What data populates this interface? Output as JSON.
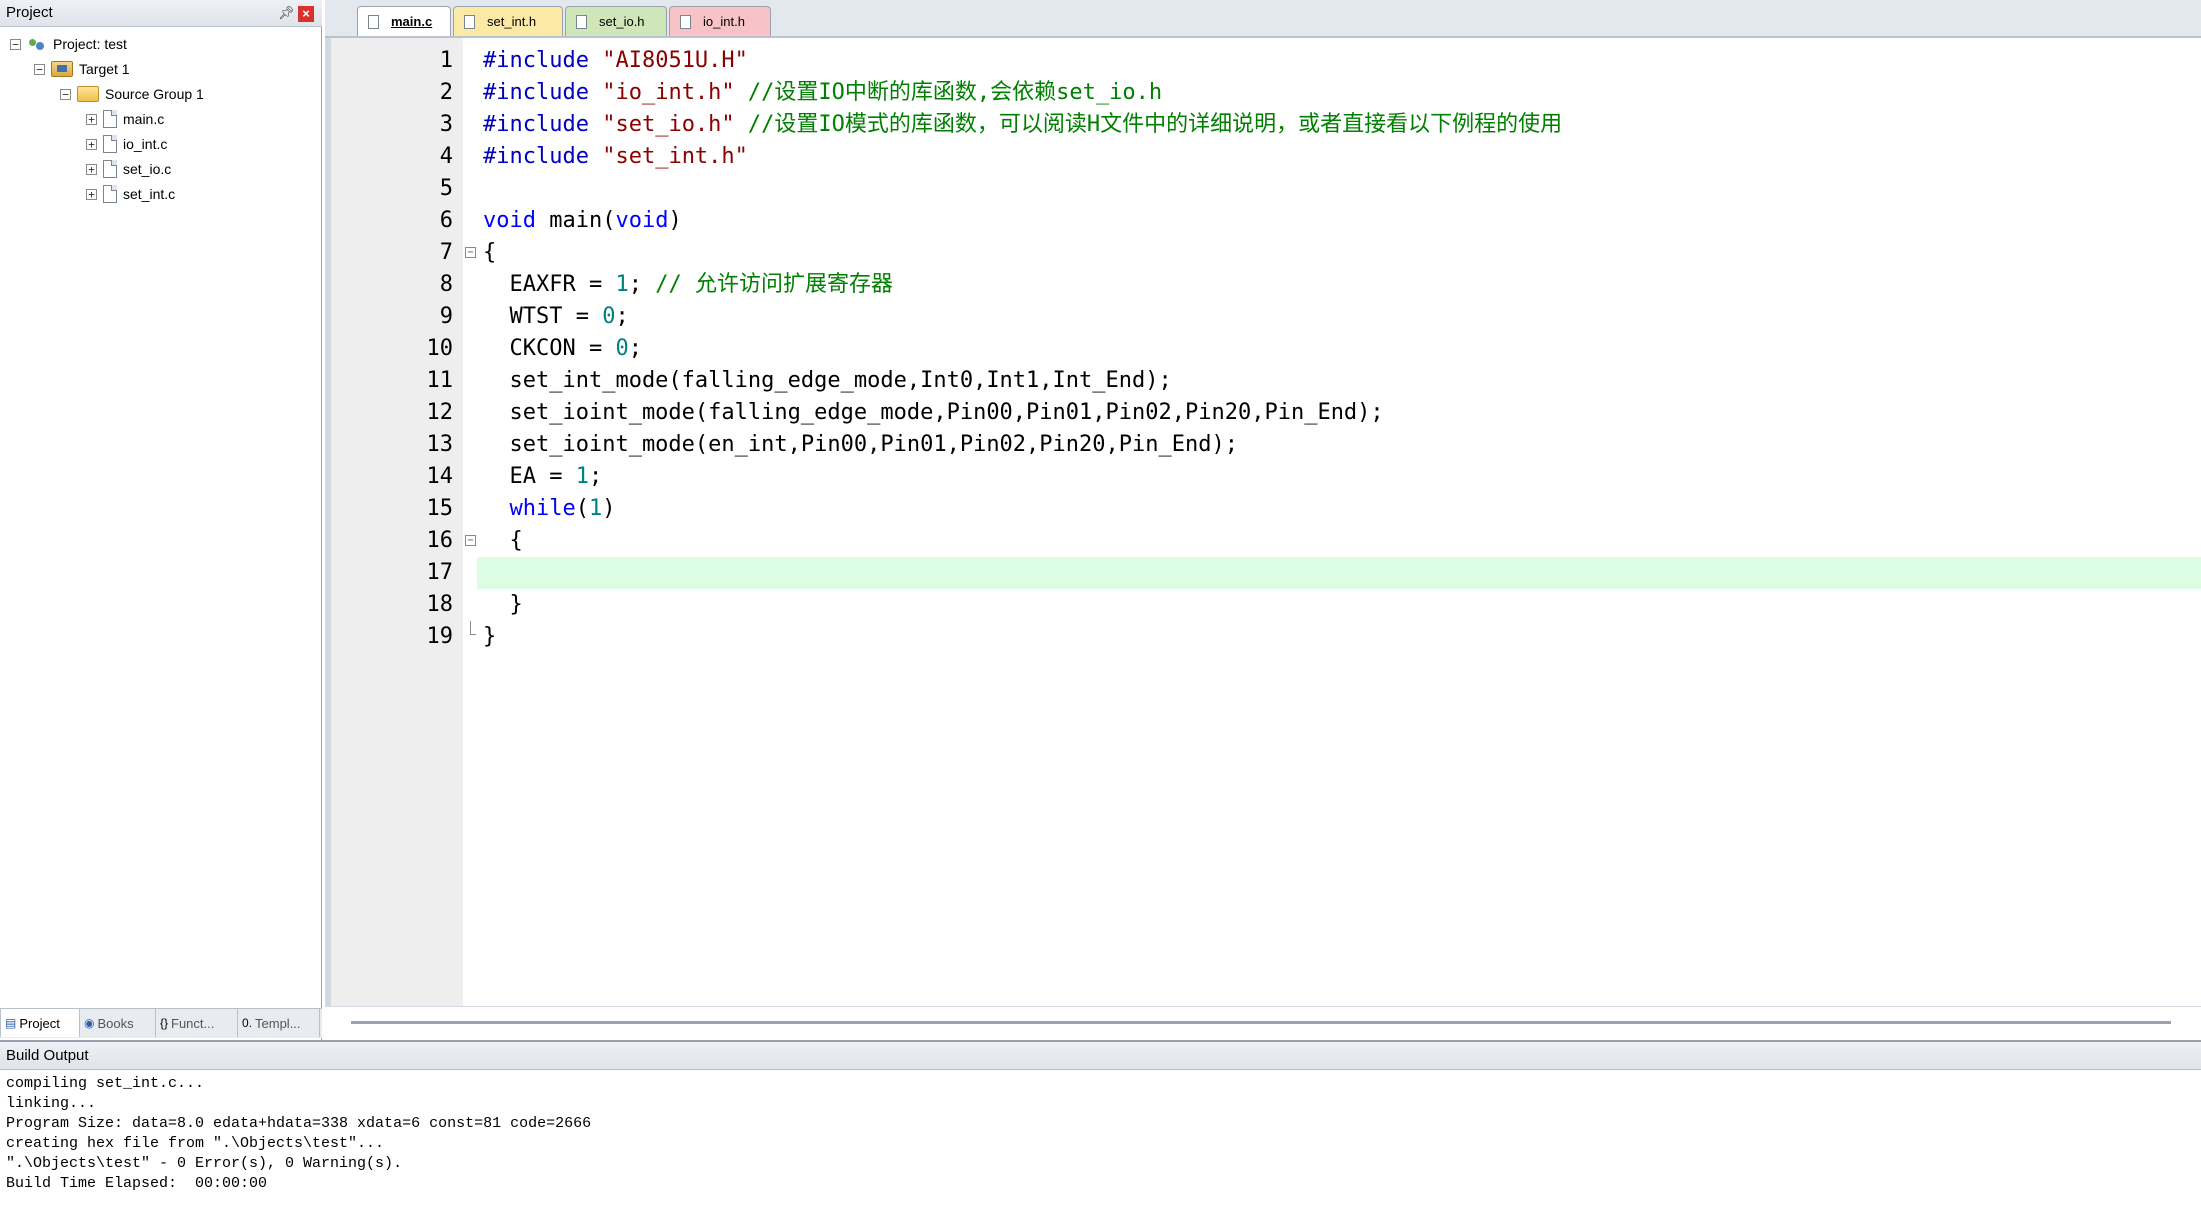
{
  "project_panel": {
    "title": "Project",
    "tree": {
      "project_label": "Project: test",
      "target_label": "Target 1",
      "group_label": "Source Group 1",
      "files": [
        "main.c",
        "io_int.c",
        "set_io.c",
        "set_int.c"
      ]
    },
    "tabs": [
      {
        "label": "Project",
        "icon": "project-icon"
      },
      {
        "label": "Books",
        "icon": "books-icon"
      },
      {
        "label": "Funct...",
        "icon": "functions-icon"
      },
      {
        "label": "Templ...",
        "icon": "templates-icon"
      }
    ]
  },
  "editor": {
    "tabs": [
      {
        "label": "main.c",
        "state": "active"
      },
      {
        "label": "set_int.h",
        "state": "yellow"
      },
      {
        "label": "set_io.h",
        "state": "green"
      },
      {
        "label": "io_int.h",
        "state": "pink"
      }
    ],
    "current_line": 17,
    "lines": [
      {
        "num": "1",
        "tokens": [
          [
            "pp",
            "#include "
          ],
          [
            "str",
            "\"AI8051U.H\""
          ]
        ]
      },
      {
        "num": "2",
        "tokens": [
          [
            "pp",
            "#include "
          ],
          [
            "str",
            "\"io_int.h\""
          ],
          [
            "cm",
            " //设置IO中断的库函数,会依赖set_io.h"
          ]
        ]
      },
      {
        "num": "3",
        "tokens": [
          [
            "pp",
            "#include "
          ],
          [
            "str",
            "\"set_io.h\""
          ],
          [
            "cm",
            " //设置IO模式的库函数，可以阅读H文件中的详细说明，或者直接看以下例程的使用"
          ]
        ]
      },
      {
        "num": "4",
        "tokens": [
          [
            "pp",
            "#include "
          ],
          [
            "str",
            "\"set_int.h\""
          ]
        ]
      },
      {
        "num": "5",
        "tokens": []
      },
      {
        "num": "6",
        "tokens": [
          [
            "kw",
            "void"
          ],
          [
            "tx",
            " main("
          ],
          [
            "kw",
            "void"
          ],
          [
            "tx",
            ")"
          ]
        ]
      },
      {
        "num": "7",
        "tokens": [
          [
            "tx",
            "{"
          ]
        ],
        "fold": "open"
      },
      {
        "num": "8",
        "tokens": [
          [
            "tx",
            "  EAXFR = "
          ],
          [
            "num",
            "1"
          ],
          [
            "tx",
            "; "
          ],
          [
            "cm",
            "// 允许访问扩展寄存器"
          ]
        ]
      },
      {
        "num": "9",
        "tokens": [
          [
            "tx",
            "  WTST = "
          ],
          [
            "num",
            "0"
          ],
          [
            "tx",
            ";"
          ]
        ]
      },
      {
        "num": "10",
        "tokens": [
          [
            "tx",
            "  CKCON = "
          ],
          [
            "num",
            "0"
          ],
          [
            "tx",
            ";"
          ]
        ]
      },
      {
        "num": "11",
        "tokens": [
          [
            "tx",
            "  set_int_mode(falling_edge_mode,Int0,Int1,Int_End);"
          ]
        ]
      },
      {
        "num": "12",
        "tokens": [
          [
            "tx",
            "  set_ioint_mode(falling_edge_mode,Pin00,Pin01,Pin02,Pin20,Pin_End);"
          ]
        ]
      },
      {
        "num": "13",
        "tokens": [
          [
            "tx",
            "  set_ioint_mode(en_int,Pin00,Pin01,Pin02,Pin20,Pin_End);"
          ]
        ]
      },
      {
        "num": "14",
        "tokens": [
          [
            "tx",
            "  EA = "
          ],
          [
            "num",
            "1"
          ],
          [
            "tx",
            ";"
          ]
        ]
      },
      {
        "num": "15",
        "tokens": [
          [
            "tx",
            "  "
          ],
          [
            "kw",
            "while"
          ],
          [
            "tx",
            "("
          ],
          [
            "num",
            "1"
          ],
          [
            "tx",
            ")"
          ]
        ]
      },
      {
        "num": "16",
        "tokens": [
          [
            "tx",
            "  {"
          ]
        ],
        "fold": "open"
      },
      {
        "num": "17",
        "tokens": []
      },
      {
        "num": "18",
        "tokens": [
          [
            "tx",
            "  }"
          ]
        ]
      },
      {
        "num": "19",
        "tokens": [
          [
            "tx",
            "}"
          ]
        ],
        "fold": "end"
      }
    ]
  },
  "build_output": {
    "title": "Build Output",
    "lines": [
      "compiling set_int.c...",
      "linking...",
      "Program Size: data=8.0 edata+hdata=338 xdata=6 const=81 code=2666",
      "creating hex file from \".\\Objects\\test\"...",
      "\".\\Objects\\test\" - 0 Error(s), 0 Warning(s).",
      "Build Time Elapsed:  00:00:00"
    ]
  },
  "colors": {
    "preprocessor": "#0000c0",
    "string": "#8b0000",
    "comment": "#008000",
    "keyword": "#0000ff",
    "number": "#008080",
    "current_line_bg": "#dcfce4"
  }
}
